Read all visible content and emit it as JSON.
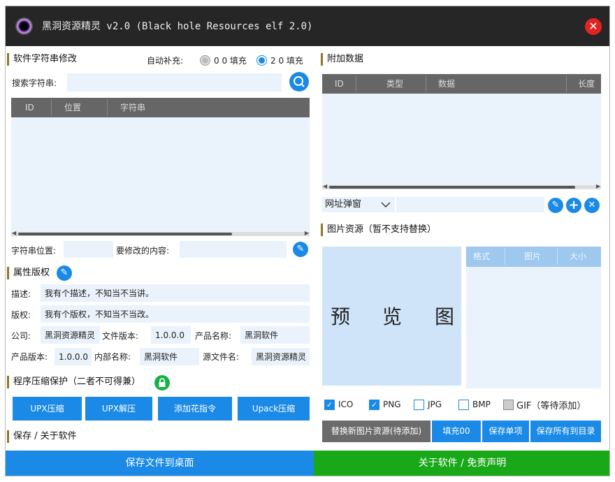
{
  "window": {
    "title": "黑洞资源精灵 v2.0 (Black hole Resources elf 2.0)"
  },
  "strings_section": {
    "title": "软件字符串修改",
    "autofill_label": "自动补充:",
    "option_00": "0 0 填充",
    "option_20": "2 0 填充",
    "selected_option": "20",
    "search_label": "搜索字符串:",
    "search_value": "",
    "columns": [
      "ID",
      "位置",
      "字符串"
    ],
    "rows": [],
    "position_label": "字符串位置:",
    "position_value": "",
    "content_label": "要修改的内容:",
    "content_value": ""
  },
  "copyright_section": {
    "title": "属性版权",
    "description_label": "描述:",
    "description_value": "我有个描述，不知当不当讲。",
    "copyright_label": "版权:",
    "copyright_value": "我有个版权，不知当不当改。",
    "company_label": "公司:",
    "company_value": "黑洞资源精灵",
    "file_version_label": "文件版本:",
    "file_version_value": "1.0.0.0",
    "product_name_label": "产品名称:",
    "product_name_value": "黑洞软件",
    "product_version_label": "产品版本:",
    "product_version_value": "1.0.0.0",
    "internal_name_label": "内部名称:",
    "internal_name_value": "黑洞软件",
    "source_file_label": "源文件名:",
    "source_file_value": "黑洞资源精灵"
  },
  "compress_section": {
    "title": "程序压缩保护（二者不可得兼）",
    "buttons": [
      "UPX压缩",
      "UPX解压",
      "添加花指令",
      "Upack压缩"
    ]
  },
  "save_section": {
    "title": "保存 / 关于软件"
  },
  "extra_data_section": {
    "title": "附加数据",
    "columns": [
      "ID",
      "类型",
      "数据",
      "长度"
    ],
    "rows": [],
    "select_value": "网址弹窗",
    "input_value": ""
  },
  "image_section": {
    "title": "图片资源（暂不支持替换）",
    "preview_chars": [
      "预",
      "览",
      "图"
    ],
    "columns": [
      "格式",
      "图片",
      "大小"
    ],
    "rows": [],
    "checkboxes": [
      {
        "label": "ICO",
        "checked": true
      },
      {
        "label": "PNG",
        "checked": true
      },
      {
        "label": "JPG",
        "checked": false
      },
      {
        "label": "BMP",
        "checked": false
      },
      {
        "label": "GIF（等待添加）",
        "checked": false
      }
    ],
    "actions": [
      "替换新图片资源(待添加)",
      "填充00",
      "保存单项",
      "保存所有到目录"
    ]
  },
  "bottom": {
    "save_label": "保存文件到桌面",
    "about_label": "关于软件 / 免责声明"
  },
  "colors": {
    "accent": "#1a8ae6",
    "titlebar": "#262626",
    "field_bg": "#eaf2fb",
    "close": "#e02424",
    "about_green": "#18a818",
    "gray_button": "#6b6b6b"
  }
}
